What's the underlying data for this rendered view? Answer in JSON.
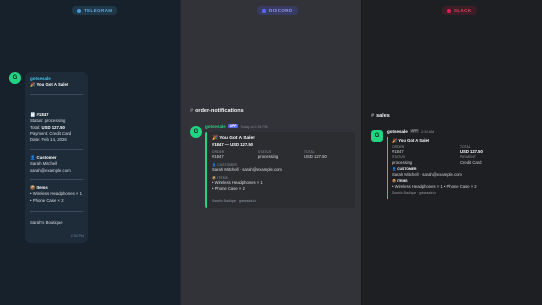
{
  "panels": {
    "telegram": "TELEGRAM",
    "discord": "DISCORD",
    "slack": "SLACK"
  },
  "brand_colors": {
    "telegram": "#3d9be0",
    "discord": "#5865f2",
    "slack": "#e01e5a",
    "accent": "#20d484"
  },
  "avatar_letter": "G",
  "telegram": {
    "sender": "gotsesale",
    "headline": "🎉 You Got A Sale!",
    "order": "🧾 #1847",
    "status": "Status: processing",
    "total_label": "Total: ",
    "total": "USD 127.50",
    "payment": "Payment: Credit Card",
    "date": "Date: Feb 14, 2026",
    "customer_heading": "👤 Customer",
    "customer_name": "Sarah Mitchell",
    "customer_email": "sarah@example.com",
    "items_heading": "📦 Items",
    "item1": "• Wireless Headphones × 1",
    "item2": "• Phone Case × 2",
    "store": "Sarah's Boutique",
    "time": "2:34 PM"
  },
  "discord": {
    "channel": "order-notifications",
    "sender": "gotsesale",
    "badge": "APP",
    "time": "Today at 2:34 PM",
    "title": "🎉 You Got A Sale!",
    "subtitle": "#1847 — USD 127.50",
    "fields": [
      {
        "label": "ORDER",
        "value": "#1847"
      },
      {
        "label": "STATUS",
        "value": "processing"
      },
      {
        "label": "TOTAL",
        "value": "USD 127.50"
      }
    ],
    "customer_label": "👤 CUSTOMER",
    "customer": "Sarah Mitchell · sarah@example.com",
    "items_label": "📦 ITEMS",
    "item1": "• Wireless Headphones × 1",
    "item2": "• Phone Case × 2",
    "footer": "Sarah's Boutique · gotsesale.io"
  },
  "slack": {
    "channel": "sales",
    "sender": "gotsesale",
    "badge": "APP",
    "time": "2:34 AM",
    "title": "🎉 You Got A Sale!",
    "order_label": "ORDER",
    "order": "#1847",
    "total_label": "TOTAL",
    "total": "USD 127.50",
    "status_label": "STATUS",
    "status": "processing",
    "payment_label": "PAYMENT",
    "payment": "Credit Card",
    "customer_label": "👤 CUSTOMER",
    "customer": "Sarah Mitchell · sarah@example.com",
    "items_label": "📦 ITEMS",
    "items": "• Wireless Headphones × 1 • Phone Case × 2",
    "footer": "Sarah's Boutique · gotsesale.io"
  }
}
